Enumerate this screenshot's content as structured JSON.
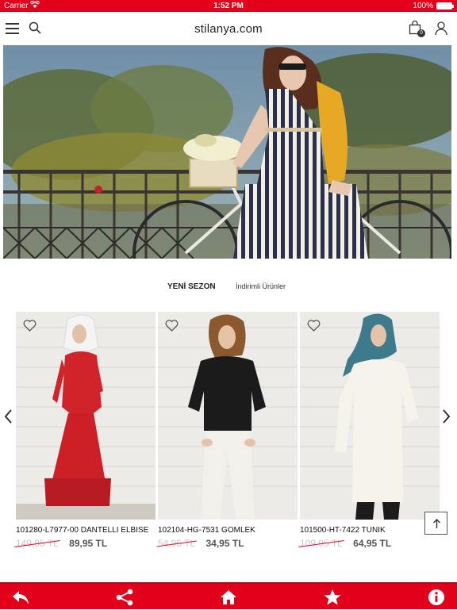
{
  "status_bar": {
    "carrier": "Carrier",
    "time": "1:52 PM",
    "battery": "100%"
  },
  "header": {
    "logo": "stilanya.com",
    "cart_count": "0",
    "icons": [
      "menu-icon",
      "search-icon",
      "shopping-bag-icon",
      "user-icon"
    ]
  },
  "tabs": {
    "active": "YENİ SEZON",
    "other": "İndirimli Ürünler"
  },
  "products": [
    {
      "name": "101280-L7977-00 DANTELLI ELBISE",
      "old_price": "149,95 TL",
      "price": "89,95 TL"
    },
    {
      "name": "102104-HG-7531 GOMLEK",
      "old_price": "54,95 TL",
      "price": "34,95 TL"
    },
    {
      "name": "101500-HT-7422 TUNIK",
      "old_price": "109,95 TL",
      "price": "64,95 TL"
    }
  ],
  "bottom_bar": {
    "icons": [
      "back-icon",
      "share-icon",
      "home-icon",
      "star-icon",
      "info-icon"
    ]
  },
  "colors": {
    "brand_red": "#e3001b",
    "old_price": "#c8c8c8",
    "new_price": "#555555"
  }
}
